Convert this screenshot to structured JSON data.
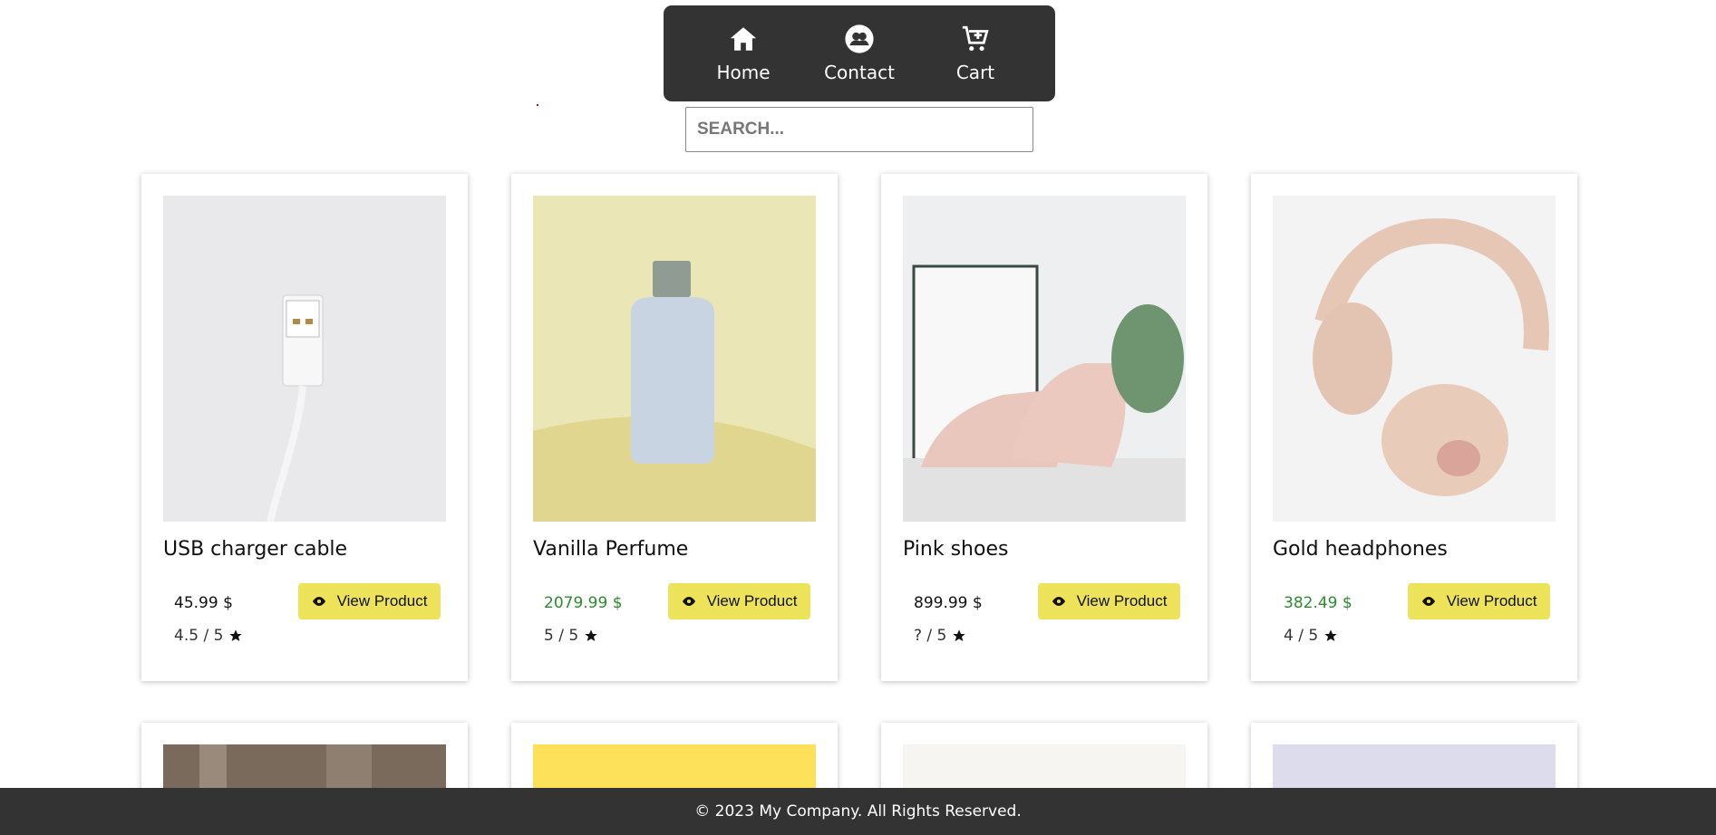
{
  "nav": {
    "items": [
      {
        "label": "Home",
        "icon": "home-icon"
      },
      {
        "label": "Contact",
        "icon": "contact-icon"
      },
      {
        "label": "Cart",
        "icon": "cart-icon"
      }
    ]
  },
  "search": {
    "placeholder": "SEARCH..."
  },
  "products": [
    {
      "title": "USB charger cable",
      "price": "45.99 $",
      "rating": "4.5 / 5",
      "button": "View Product",
      "price_color": "#111111"
    },
    {
      "title": "Vanilla Perfume",
      "price": "2079.99 $",
      "rating": "5 / 5",
      "button": "View Product",
      "price_color": "#2e8b2e"
    },
    {
      "title": "Pink shoes",
      "price": "899.99 $",
      "rating": "? / 5",
      "button": "View Product",
      "price_color": "#111111"
    },
    {
      "title": "Gold headphones",
      "price": "382.49 $",
      "rating": "4 / 5",
      "button": "View Product",
      "price_color": "#2e8b2e"
    }
  ],
  "footer": {
    "text": "© 2023 My Company. All Rights Reserved."
  },
  "colors": {
    "nav_bg": "#333333",
    "button_bg": "#ede35b",
    "footer_bg": "#333333"
  }
}
